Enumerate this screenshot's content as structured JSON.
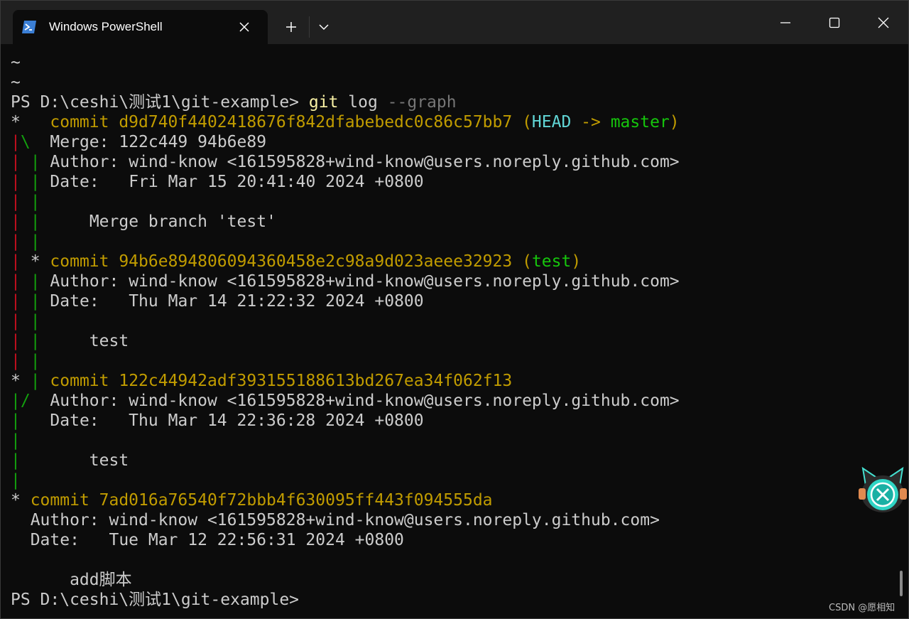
{
  "window": {
    "tab_title": "Windows PowerShell"
  },
  "colors": {
    "background": "#0c0c0c",
    "titlebar": "#202020",
    "text": "#cccccc",
    "commit_hash": "#c19c00",
    "graph_red": "#c50f1f",
    "graph_green": "#13a10e",
    "head": "#61d6d6",
    "branch": "#16c60c",
    "git_cmd": "#f9f1a5",
    "dim_arg": "#767676"
  },
  "icons": {
    "tab": "powershell-icon",
    "close_tab": "close-icon",
    "new_tab": "plus-icon",
    "dropdown": "chevron-down-icon",
    "minimize": "minimize-icon",
    "maximize": "maximize-icon",
    "close": "close-icon"
  },
  "terminal": {
    "lines": [
      [
        {
          "t": "~",
          "c": "default"
        }
      ],
      [
        {
          "t": "~",
          "c": "default"
        }
      ],
      [
        {
          "t": "PS D:\\ceshi\\测试1\\git-example> ",
          "c": "default"
        },
        {
          "t": "git",
          "c": "bright-yellow"
        },
        {
          "t": " log ",
          "c": "default"
        },
        {
          "t": "--graph",
          "c": "gray"
        }
      ],
      [
        {
          "t": "*   ",
          "c": "default"
        },
        {
          "t": "commit d9d740f4402418676f842dfabebedc0c86c57bb7 ",
          "c": "yellow"
        },
        {
          "t": "(",
          "c": "yellow"
        },
        {
          "t": "HEAD",
          "c": "bright-cyan"
        },
        {
          "t": " -> ",
          "c": "yellow"
        },
        {
          "t": "master",
          "c": "bright-green"
        },
        {
          "t": ")",
          "c": "yellow"
        }
      ],
      [
        {
          "t": "|",
          "c": "red"
        },
        {
          "t": "\\",
          "c": "green"
        },
        {
          "t": "  Merge: 122c449 94b6e89",
          "c": "default"
        }
      ],
      [
        {
          "t": "|",
          "c": "red"
        },
        {
          "t": " ",
          "c": "default"
        },
        {
          "t": "|",
          "c": "green"
        },
        {
          "t": " Author: wind-know <161595828+wind-know@users.noreply.github.com>",
          "c": "default"
        }
      ],
      [
        {
          "t": "|",
          "c": "red"
        },
        {
          "t": " ",
          "c": "default"
        },
        {
          "t": "|",
          "c": "green"
        },
        {
          "t": " Date:   Fri Mar 15 20:41:40 2024 +0800",
          "c": "default"
        }
      ],
      [
        {
          "t": "|",
          "c": "red"
        },
        {
          "t": " ",
          "c": "default"
        },
        {
          "t": "|",
          "c": "green"
        }
      ],
      [
        {
          "t": "|",
          "c": "red"
        },
        {
          "t": " ",
          "c": "default"
        },
        {
          "t": "|",
          "c": "green"
        },
        {
          "t": "     Merge branch 'test'",
          "c": "default"
        }
      ],
      [
        {
          "t": "|",
          "c": "red"
        },
        {
          "t": " ",
          "c": "default"
        },
        {
          "t": "|",
          "c": "green"
        }
      ],
      [
        {
          "t": "|",
          "c": "red"
        },
        {
          "t": " * ",
          "c": "default"
        },
        {
          "t": "commit 94b6e894806094360458e2c98a9d023aeee32923 ",
          "c": "yellow"
        },
        {
          "t": "(",
          "c": "yellow"
        },
        {
          "t": "test",
          "c": "bright-green"
        },
        {
          "t": ")",
          "c": "yellow"
        }
      ],
      [
        {
          "t": "|",
          "c": "red"
        },
        {
          "t": " ",
          "c": "default"
        },
        {
          "t": "|",
          "c": "green"
        },
        {
          "t": " Author: wind-know <161595828+wind-know@users.noreply.github.com>",
          "c": "default"
        }
      ],
      [
        {
          "t": "|",
          "c": "red"
        },
        {
          "t": " ",
          "c": "default"
        },
        {
          "t": "|",
          "c": "green"
        },
        {
          "t": " Date:   Thu Mar 14 21:22:32 2024 +0800",
          "c": "default"
        }
      ],
      [
        {
          "t": "|",
          "c": "red"
        },
        {
          "t": " ",
          "c": "default"
        },
        {
          "t": "|",
          "c": "green"
        }
      ],
      [
        {
          "t": "|",
          "c": "red"
        },
        {
          "t": " ",
          "c": "default"
        },
        {
          "t": "|",
          "c": "green"
        },
        {
          "t": "     test",
          "c": "default"
        }
      ],
      [
        {
          "t": "|",
          "c": "red"
        },
        {
          "t": " ",
          "c": "default"
        },
        {
          "t": "|",
          "c": "green"
        }
      ],
      [
        {
          "t": "* ",
          "c": "default"
        },
        {
          "t": "|",
          "c": "green"
        },
        {
          "t": " ",
          "c": "default"
        },
        {
          "t": "commit 122c44942adf393155188613bd267ea34f062f13",
          "c": "yellow"
        }
      ],
      [
        {
          "t": "|",
          "c": "green"
        },
        {
          "t": "/",
          "c": "green"
        },
        {
          "t": "  Author: wind-know <161595828+wind-know@users.noreply.github.com>",
          "c": "default"
        }
      ],
      [
        {
          "t": "|",
          "c": "green"
        },
        {
          "t": "   Date:   Thu Mar 14 22:36:28 2024 +0800",
          "c": "default"
        }
      ],
      [
        {
          "t": "|",
          "c": "green"
        }
      ],
      [
        {
          "t": "|",
          "c": "green"
        },
        {
          "t": "       test",
          "c": "default"
        }
      ],
      [
        {
          "t": "|",
          "c": "green"
        }
      ],
      [
        {
          "t": "* ",
          "c": "default"
        },
        {
          "t": "commit 7ad016a76540f72bbb4f630095ff443f094555da",
          "c": "yellow"
        }
      ],
      [
        {
          "t": "  Author: wind-know <161595828+wind-know@users.noreply.github.com>",
          "c": "default"
        }
      ],
      [
        {
          "t": "  Date:   Tue Mar 12 22:56:31 2024 +0800",
          "c": "default"
        }
      ],
      [
        {
          "t": "",
          "c": "default"
        }
      ],
      [
        {
          "t": "      add脚本",
          "c": "default"
        }
      ],
      [
        {
          "t": "PS D:\\ceshi\\测试1\\git-example>",
          "c": "default"
        }
      ]
    ]
  },
  "watermark": "CSDN @愿相知"
}
